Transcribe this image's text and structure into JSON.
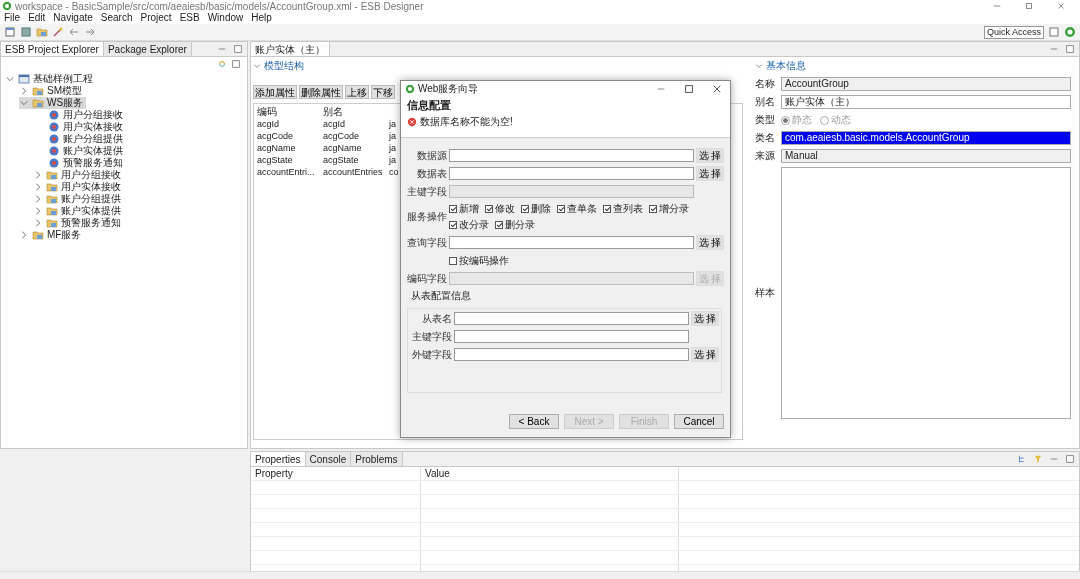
{
  "window": {
    "title": "workspace - BasicSample/src/com/aeaiesb/basic/models/AccountGroup.xml - ESB Designer"
  },
  "menu": [
    "File",
    "Edit",
    "Navigate",
    "Search",
    "Project",
    "ESB",
    "Window",
    "Help"
  ],
  "toolbar": {
    "quick_access": "Quick Access"
  },
  "explorer": {
    "tabs": [
      {
        "label": "ESB Project Explorer",
        "selected": true
      },
      {
        "label": "Package Explorer",
        "selected": false
      }
    ],
    "tree": [
      {
        "label": "基础样例工程",
        "kind": "project",
        "expanded": true,
        "selected": false,
        "children": [
          {
            "label": "SM模型",
            "kind": "folder",
            "expanded": false,
            "selected": false
          },
          {
            "label": "WS服务",
            "kind": "folder",
            "expanded": true,
            "selected": true,
            "children": [
              {
                "label": "用户分组接收",
                "kind": "service",
                "selected": false
              },
              {
                "label": "用户实体接收",
                "kind": "service",
                "selected": false
              },
              {
                "label": "账户分组提供",
                "kind": "service",
                "selected": false
              },
              {
                "label": "账户实体提供",
                "kind": "service",
                "selected": false
              },
              {
                "label": "预警服务通知",
                "kind": "service",
                "selected": false
              },
              {
                "label": "用户分组接收",
                "kind": "folder",
                "expanded": false,
                "selected": false
              },
              {
                "label": "用户实体接收",
                "kind": "folder",
                "expanded": false,
                "selected": false
              },
              {
                "label": "账户分组提供",
                "kind": "folder",
                "expanded": false,
                "selected": false
              },
              {
                "label": "账户实体提供",
                "kind": "folder",
                "expanded": false,
                "selected": false
              },
              {
                "label": "预警服务通知",
                "kind": "folder",
                "expanded": false,
                "selected": false
              }
            ]
          },
          {
            "label": "MF服务",
            "kind": "folder",
            "expanded": false,
            "selected": false
          }
        ]
      }
    ]
  },
  "editor": {
    "tab": {
      "label": "账户实体（主）",
      "selected": true
    },
    "section": "模型结构",
    "buttons": [
      "添加属性",
      "删除属性",
      "上移",
      "下移"
    ],
    "table": {
      "columns": [
        "编码",
        "别名"
      ],
      "rows": [
        [
          "acgId",
          "acgId",
          "ja"
        ],
        [
          "acgCode",
          "acgCode",
          "ja"
        ],
        [
          "acgName",
          "acgName",
          "ja"
        ],
        [
          "acgState",
          "acgState",
          "ja"
        ],
        [
          "accountEntri...",
          "accountEntries",
          "co"
        ]
      ]
    }
  },
  "details": {
    "section": "基本信息",
    "fields": [
      {
        "label": "名称",
        "kind": "readonly",
        "value": "AccountGroup"
      },
      {
        "label": "别名",
        "kind": "text",
        "value": "账户实体（主）"
      },
      {
        "label": "类型",
        "kind": "radio",
        "options": [
          {
            "label": "静态",
            "selected": true
          },
          {
            "label": "动态",
            "selected": false
          }
        ]
      },
      {
        "label": "类名",
        "kind": "highlighted",
        "value": "com.aeaiesb.basic.models.AccountGroup"
      },
      {
        "label": "来源",
        "kind": "readonly",
        "value": "Manual"
      },
      {
        "label": "样本",
        "kind": "textarea"
      }
    ]
  },
  "dialog": {
    "title": "Web服务向导",
    "heading": "信息配置",
    "error": "数据库名称不能为空!",
    "rows": [
      {
        "kind": "field",
        "label": "数据源",
        "button": "选 择",
        "disabled": false
      },
      {
        "kind": "field",
        "label": "数据表",
        "button": "选 择",
        "disabled": false
      },
      {
        "kind": "field",
        "label": "主键字段",
        "disabled": true
      },
      {
        "kind": "checks",
        "label": "服务操作",
        "options": [
          {
            "label": "新增",
            "checked": true
          },
          {
            "label": "修改",
            "checked": true
          },
          {
            "label": "删除",
            "checked": true
          },
          {
            "label": "查单条",
            "checked": true
          },
          {
            "label": "查列表",
            "checked": true
          },
          {
            "label": "增分录",
            "checked": true
          },
          {
            "label": "改分录",
            "checked": true
          },
          {
            "label": "删分录",
            "checked": true
          }
        ]
      },
      {
        "kind": "field",
        "label": "查询字段",
        "button": "选 择",
        "disabled": false
      },
      {
        "kind": "checkbox",
        "label": "按编码操作",
        "checked": false
      },
      {
        "kind": "field",
        "label": "编码字段",
        "button": "选 择",
        "disabled": true
      }
    ],
    "group": {
      "title": "从表配置信息",
      "rows": [
        {
          "kind": "field",
          "label": "从表名",
          "button": "选 择",
          "disabled": false
        },
        {
          "kind": "field",
          "label": "主键字段",
          "disabled": false
        },
        {
          "kind": "field",
          "label": "外键字段",
          "button": "选 择",
          "disabled": false
        }
      ]
    },
    "buttons": [
      {
        "label": "< Back",
        "disabled": false
      },
      {
        "label": "Next >",
        "disabled": true
      },
      {
        "label": "Finish",
        "disabled": true
      },
      {
        "label": "Cancel",
        "disabled": false
      }
    ]
  },
  "bottom": {
    "tabs": [
      {
        "label": "Properties",
        "selected": true
      },
      {
        "label": "Console",
        "selected": false
      },
      {
        "label": "Problems",
        "selected": false
      }
    ],
    "columns": [
      "Property",
      "Value"
    ]
  }
}
